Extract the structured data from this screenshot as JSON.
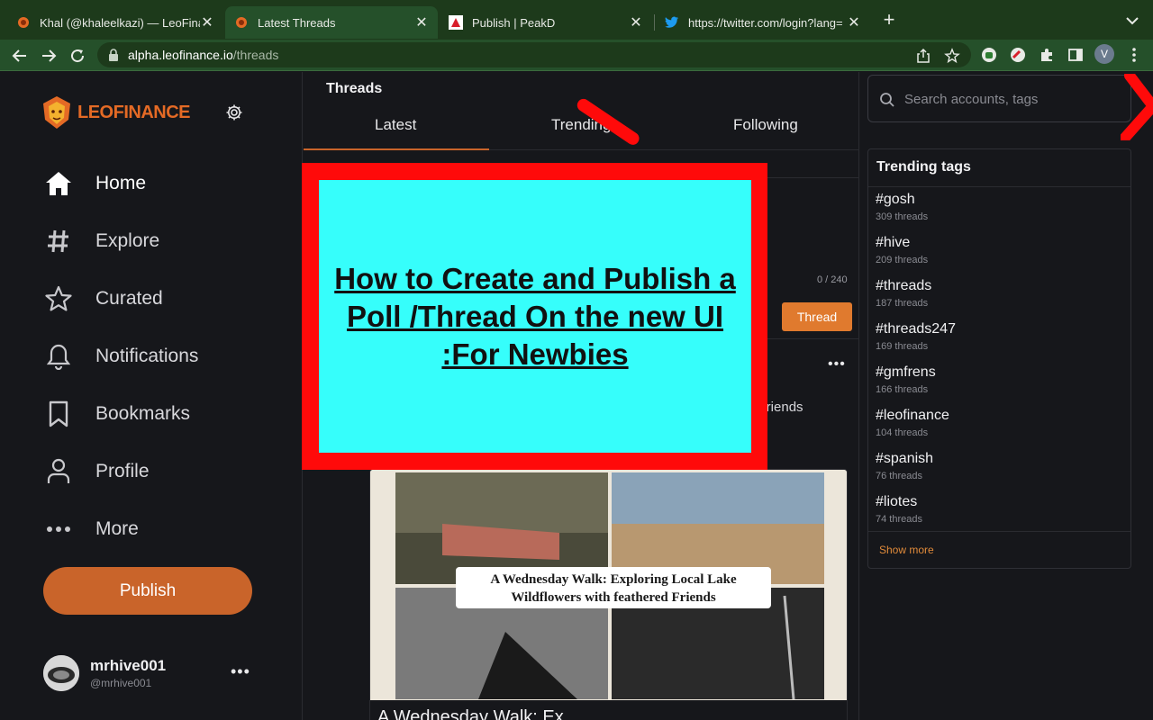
{
  "browser": {
    "tabs": [
      {
        "title": "Khal (@khaleelkazi) — LeoFina",
        "active": false
      },
      {
        "title": "Latest Threads",
        "active": true
      },
      {
        "title": "Publish | PeakD",
        "active": false
      },
      {
        "title": "https://twitter.com/login?lang=",
        "active": false
      }
    ],
    "url_host": "alpha.leofinance.io",
    "url_path": "/threads",
    "profile_initial": "V"
  },
  "brand": {
    "logo_text": "LEOFINANCE",
    "accent": "#c9642a"
  },
  "sidebar": {
    "items": [
      {
        "label": "Home",
        "icon": "home-icon"
      },
      {
        "label": "Explore",
        "icon": "hash-icon"
      },
      {
        "label": "Curated",
        "icon": "star-icon"
      },
      {
        "label": "Notifications",
        "icon": "bell-icon"
      },
      {
        "label": "Bookmarks",
        "icon": "bookmark-icon"
      },
      {
        "label": "Profile",
        "icon": "user-icon"
      },
      {
        "label": "More",
        "icon": "ellipsis-icon"
      }
    ],
    "publish_label": "Publish",
    "user": {
      "name": "mrhive001",
      "handle": "@mrhive001"
    }
  },
  "main": {
    "heading": "Threads",
    "tabs": [
      "Latest",
      "Trending",
      "Following"
    ],
    "active_tab": "Latest",
    "char_counter": "0 / 240",
    "thread_button": "Thread",
    "post_snippet": "d friends",
    "post_title": "A Wednesday Walk: Ex",
    "post_image_caption_line1": "A Wednesday Walk: Exploring Local Lake",
    "post_image_caption_line2": "Wildflowers with feathered Friends"
  },
  "overlay": {
    "text": "How to Create and Publish a Poll /Thread On the new UI :For Newbies",
    "border_color": "#ff0a0a",
    "fill_color": "#36fefb"
  },
  "right": {
    "search_placeholder": "Search accounts, tags",
    "trending_heading": "Trending tags",
    "tags": [
      {
        "tag": "#gosh",
        "count": "309 threads"
      },
      {
        "tag": "#hive",
        "count": "209 threads"
      },
      {
        "tag": "#threads",
        "count": "187 threads"
      },
      {
        "tag": "#threads247",
        "count": "169 threads"
      },
      {
        "tag": "#gmfrens",
        "count": "166 threads"
      },
      {
        "tag": "#leofinance",
        "count": "104 threads"
      },
      {
        "tag": "#spanish",
        "count": "76 threads"
      },
      {
        "tag": "#liotes",
        "count": "74 threads"
      }
    ],
    "show_more": "Show more"
  }
}
